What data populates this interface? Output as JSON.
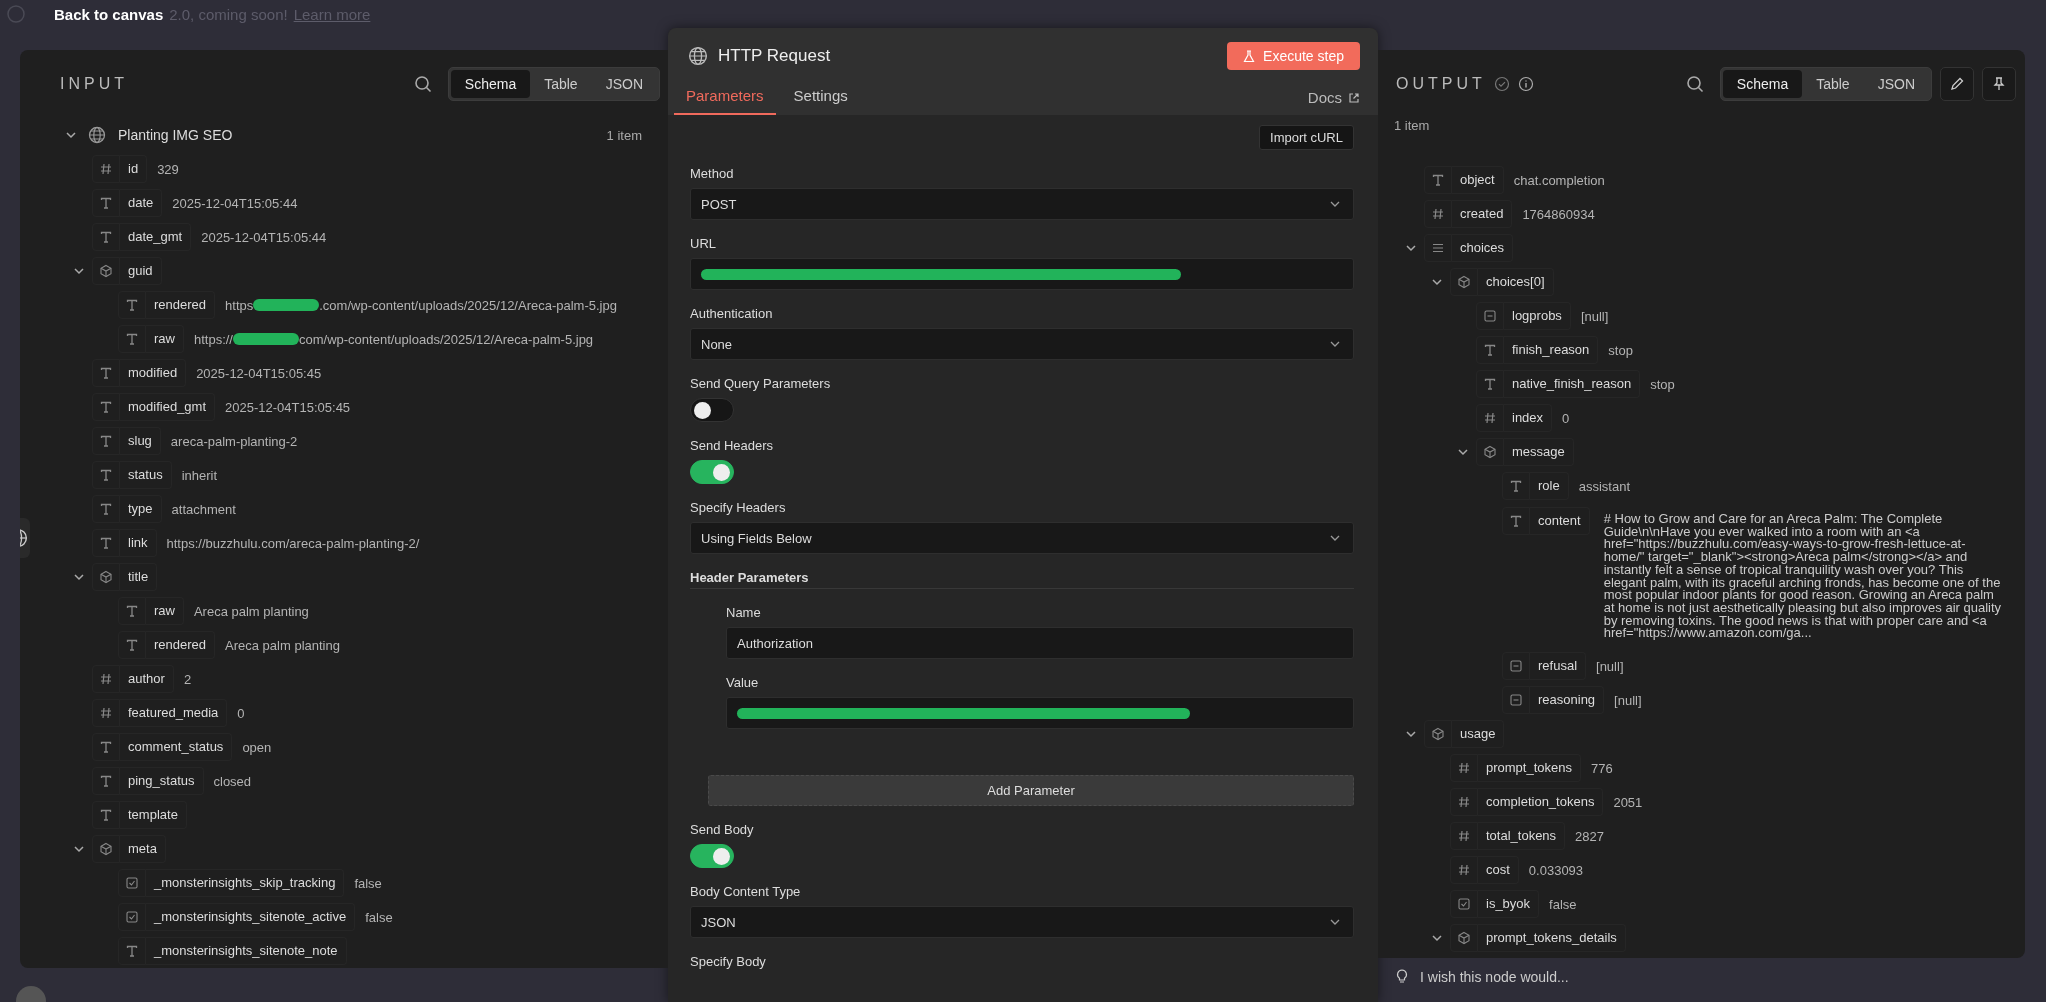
{
  "top_bar": {
    "back": "Back to canvas",
    "banner": "2.0, coming soon!",
    "link": "Learn more"
  },
  "input": {
    "title": "INPUT",
    "views": [
      {
        "label": "Schema",
        "selected": true
      },
      {
        "label": "Table",
        "selected": false
      },
      {
        "label": "JSON",
        "selected": false
      }
    ],
    "node": {
      "name": "Planting IMG SEO",
      "count": "1 item",
      "expanded": true
    },
    "tree": [
      {
        "kind": "number",
        "key": "id",
        "value": "329"
      },
      {
        "kind": "string",
        "key": "date",
        "value": "2025-12-04T15:05:44"
      },
      {
        "kind": "string",
        "key": "date_gmt",
        "value": "2025-12-04T15:05:44"
      },
      {
        "kind": "object",
        "key": "guid",
        "expanded": true,
        "children": [
          {
            "kind": "string",
            "key": "rendered",
            "value_start": "https",
            "value_end": ".com/wp-content/uploads/2025/12/Areca-palm-5.jpg",
            "redacted": true
          },
          {
            "kind": "string",
            "key": "raw",
            "value_start": "https://",
            "value_end": "com/wp-content/uploads/2025/12/Areca-palm-5.jpg",
            "redacted": true
          }
        ]
      },
      {
        "kind": "string",
        "key": "modified",
        "value": "2025-12-04T15:05:45"
      },
      {
        "kind": "string",
        "key": "modified_gmt",
        "value": "2025-12-04T15:05:45"
      },
      {
        "kind": "string",
        "key": "slug",
        "value": "areca-palm-planting-2"
      },
      {
        "kind": "string",
        "key": "status",
        "value": "inherit"
      },
      {
        "kind": "string",
        "key": "type",
        "value": "attachment"
      },
      {
        "kind": "string",
        "key": "link",
        "value": "https://buzzhulu.com/areca-palm-planting-2/"
      },
      {
        "kind": "object",
        "key": "title",
        "expanded": true,
        "children": [
          {
            "kind": "string",
            "key": "raw",
            "value": "Areca palm planting"
          },
          {
            "kind": "string",
            "key": "rendered",
            "value": "Areca palm planting"
          }
        ]
      },
      {
        "kind": "number",
        "key": "author",
        "value": "2"
      },
      {
        "kind": "number",
        "key": "featured_media",
        "value": "0"
      },
      {
        "kind": "string",
        "key": "comment_status",
        "value": "open"
      },
      {
        "kind": "string",
        "key": "ping_status",
        "value": "closed"
      },
      {
        "kind": "string",
        "key": "template"
      },
      {
        "kind": "object",
        "key": "meta",
        "expanded": true,
        "children": [
          {
            "kind": "boolean",
            "key": "_monsterinsights_skip_tracking",
            "value": "false"
          },
          {
            "kind": "boolean",
            "key": "_monsterinsights_sitenote_active",
            "value": "false"
          },
          {
            "kind": "string",
            "key": "_monsterinsights_sitenote_note"
          }
        ]
      }
    ]
  },
  "modal": {
    "title": "HTTP Request",
    "execute": "Execute step",
    "tabs": [
      {
        "label": "Parameters",
        "selected": true
      },
      {
        "label": "Settings",
        "selected": false
      }
    ],
    "docs": "Docs",
    "import": "Import cURL",
    "fields": [
      {
        "kind": "select",
        "label": "Method",
        "value": "POST"
      },
      {
        "kind": "input",
        "label": "URL",
        "redacted": true
      },
      {
        "kind": "select",
        "label": "Authentication",
        "value": "None"
      },
      {
        "kind": "toggle",
        "label": "Send Query Parameters",
        "on": false
      },
      {
        "kind": "toggle",
        "label": "Send Headers",
        "on": true
      },
      {
        "kind": "select",
        "label": "Specify Headers",
        "value": "Using Fields Below"
      },
      {
        "kind": "section",
        "label": "Header Parameters"
      },
      {
        "kind": "subinput",
        "label": "Name",
        "value": "Authorization"
      },
      {
        "kind": "subinput",
        "label": "Value",
        "redacted": true
      },
      {
        "kind": "button",
        "label": "Add Parameter"
      },
      {
        "kind": "toggle",
        "label": "Send Body",
        "on": true
      },
      {
        "kind": "select",
        "label": "Body Content Type",
        "value": "JSON"
      },
      {
        "kind": "label",
        "label": "Specify Body"
      }
    ]
  },
  "output": {
    "title": "OUTPUT",
    "views": [
      {
        "label": "Schema",
        "selected": true
      },
      {
        "label": "Table",
        "selected": false
      },
      {
        "label": "JSON",
        "selected": false
      }
    ],
    "count": "1 item",
    "tree": [
      {
        "kind": "string",
        "key": "object",
        "value": "chat.completion"
      },
      {
        "kind": "number",
        "key": "created",
        "value": "1764860934"
      },
      {
        "kind": "array",
        "key": "choices",
        "expanded": true,
        "children": [
          {
            "kind": "object",
            "key": "choices[0]",
            "expanded": true,
            "children": [
              {
                "kind": "null",
                "key": "logprobs",
                "value": "[null]"
              },
              {
                "kind": "string",
                "key": "finish_reason",
                "value": "stop"
              },
              {
                "kind": "string",
                "key": "native_finish_reason",
                "value": "stop"
              },
              {
                "kind": "number",
                "key": "index",
                "value": "0"
              },
              {
                "kind": "object",
                "key": "message",
                "expanded": true,
                "children": [
                  {
                    "kind": "string",
                    "key": "role",
                    "value": "assistant"
                  },
                  {
                    "kind": "string",
                    "key": "content",
                    "value": "# How to Grow and Care for an Areca Palm: The Complete Guide\\n\\nHave you ever walked into a room with an <a href=\"https://buzzhulu.com/easy-ways-to-grow-fresh-lettuce-at-home/\" target=\"_blank\"><strong>Areca palm</strong></a> and instantly felt a sense of tropical tranquility wash over you? This elegant palm, with its graceful arching fronds, has become one of the most popular indoor plants for good reason. Growing an Areca palm at home is not just aesthetically pleasing but also improves air quality by removing toxins. The good news is that with proper care and <a href=\"https://www.amazon.com/ga..."
                  },
                  {
                    "kind": "null",
                    "key": "refusal",
                    "value": "[null]"
                  },
                  {
                    "kind": "null",
                    "key": "reasoning",
                    "value": "[null]"
                  }
                ]
              }
            ]
          }
        ]
      },
      {
        "kind": "object",
        "key": "usage",
        "expanded": true,
        "children": [
          {
            "kind": "number",
            "key": "prompt_tokens",
            "value": "776"
          },
          {
            "kind": "number",
            "key": "completion_tokens",
            "value": "2051"
          },
          {
            "kind": "number",
            "key": "total_tokens",
            "value": "2827"
          },
          {
            "kind": "number",
            "key": "cost",
            "value": "0.033093"
          },
          {
            "kind": "boolean",
            "key": "is_byok",
            "value": "false"
          },
          {
            "kind": "object",
            "key": "prompt_tokens_details",
            "expanded": true
          }
        ]
      }
    ]
  },
  "feedback": {
    "placeholder": "I wish this node would..."
  }
}
